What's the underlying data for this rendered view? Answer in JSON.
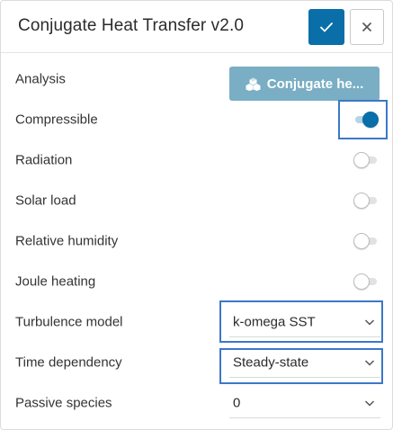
{
  "header": {
    "title": "Conjugate Heat Transfer v2.0"
  },
  "rows": {
    "analysis": {
      "label": "Analysis",
      "button_label": "Conjugate he..."
    },
    "compressible": {
      "label": "Compressible",
      "enabled": true
    },
    "radiation": {
      "label": "Radiation",
      "enabled": false
    },
    "solar_load": {
      "label": "Solar load",
      "enabled": false
    },
    "relative_humidity": {
      "label": "Relative humidity",
      "enabled": false
    },
    "joule_heating": {
      "label": "Joule heating",
      "enabled": false
    },
    "turbulence_model": {
      "label": "Turbulence model",
      "value": "k-omega SST"
    },
    "time_dependency": {
      "label": "Time dependency",
      "value": "Steady-state"
    },
    "passive_species": {
      "label": "Passive species",
      "value": "0"
    }
  },
  "icons": {
    "confirm": "checkmark-icon",
    "close": "close-icon",
    "analysis": "cubes-icon",
    "select": "chevron-down-icon"
  },
  "colors": {
    "primary": "#0a6ea8",
    "analysis_button": "#79aec4",
    "highlight": "#3b78c9"
  }
}
